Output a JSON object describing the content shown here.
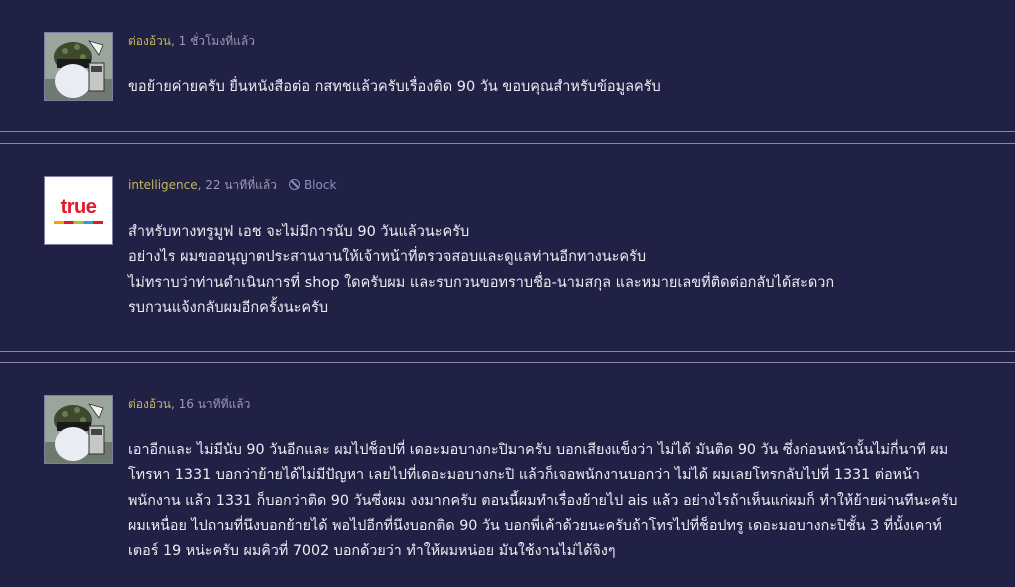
{
  "comments": [
    {
      "author": "ต่องอ้วน",
      "time": ", 1 ชั่วโมงที่แล้ว",
      "avatar_icon": "cartoon-avatar-icon",
      "lines": [
        "ขอย้ายค่ายครับ ยื่นหนังสือต่อ กสทชแล้วครับเรื่องติด 90 วัน ขอบคุณสำหรับข้อมูลครับ"
      ]
    },
    {
      "author": "intelligence",
      "time": ", 22 นาทีที่แล้ว",
      "block_label": "Block",
      "avatar_icon": "true-logo-icon",
      "avatar_logo_text": "true",
      "lines": [
        "สำหรับทางทรูมูฟ เอช จะไม่มีการนับ 90 วันแล้วนะครับ",
        "อย่างไร ผมขออนุญาตประสานงานให้เจ้าหน้าที่ตรวจสอบและดูแลท่านอีกทางนะครับ",
        "ไม่ทราบว่าท่านดำเนินการที่ shop ใดครับผม และรบกวนขอทราบชื่อ-นามสกุล และหมายเลขที่ติดต่อกลับได้สะดวก",
        "รบกวนแจ้งกลับผมอีกครั้งนะครับ"
      ]
    },
    {
      "author": "ต่องอ้วน",
      "time": ", 16 นาทีที่แล้ว",
      "avatar_icon": "cartoon-avatar-icon",
      "lines": [
        "เอาอีกและ ไม่มีนับ 90 วันอีกและ ผมไปช็อปที่ เดอะมอบางกะปิมาครับ บอกเสียงแข็งว่า ไม่ได้ มันติด 90 วัน ซึ่งก่อนหน้านั้นไม่กี่นาที ผม",
        "โทรหา 1331 บอกว่าย้ายได้ไม่มีปัญหา เลยไปที่เดอะมอบางกะปิ แล้วก็เจอพนักงานบอกว่า ไม่ได้ ผมเลยโทรกลับไปที่ 1331 ต่อหน้า",
        "พนักงาน แล้ว 1331 ก็บอกว่าติด 90 วันซึ่งผม งงมากครับ ตอนนี้ผมทำเรื่องย้ายไป ais แล้ว อย่างไรถ้าเห็นแก่ผมก็ ทำให้ย้ายผ่านทีนะครับ",
        "ผมเหนื่อย ไปถามที่นึงบอกย้ายได้ พอไปอีกที่นึงบอกติด 90 วัน บอกพี่เค้าด้วยนะครับถ้าโทรไปที่ช็อปทรู เดอะมอบางกะปิชั้น 3 ที่นั้งเคาท์",
        "เตอร์ 19 หน่ะครับ ผมคิวที่ 7002 บอกด้วยว่า ทำให้ผมหน่อย มันใช้งานไม่ได้จิงๆ"
      ]
    }
  ],
  "colors": {
    "background": "#212145",
    "author": "#c3b85a",
    "meta": "#9a9ab5",
    "text": "#ececf4",
    "separator": "#8a8aa6"
  }
}
